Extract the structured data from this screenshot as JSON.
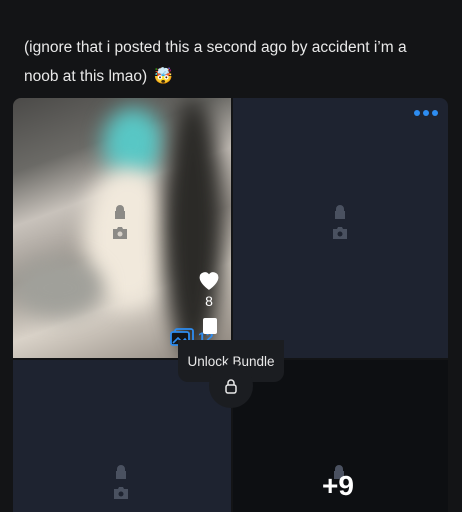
{
  "post": {
    "caption": "(ignore that i posted this a second ago by accident i’m a noob at this lmao)",
    "caption_emoji": "🤯"
  },
  "actions": {
    "more_icon": "more-dots-icon",
    "like_icon": "heart-icon",
    "like_count": "8",
    "bookmark_icon": "bookmark-icon"
  },
  "bundle": {
    "media_icon": "gallery-icon",
    "media_count": "12",
    "unlock_label": "Unlock Bundle",
    "lock_icon": "lock-icon",
    "extra_count": "+9"
  },
  "colors": {
    "accent": "#2d8cf0",
    "background": "#131416",
    "locked_tile": "#1e2330"
  }
}
